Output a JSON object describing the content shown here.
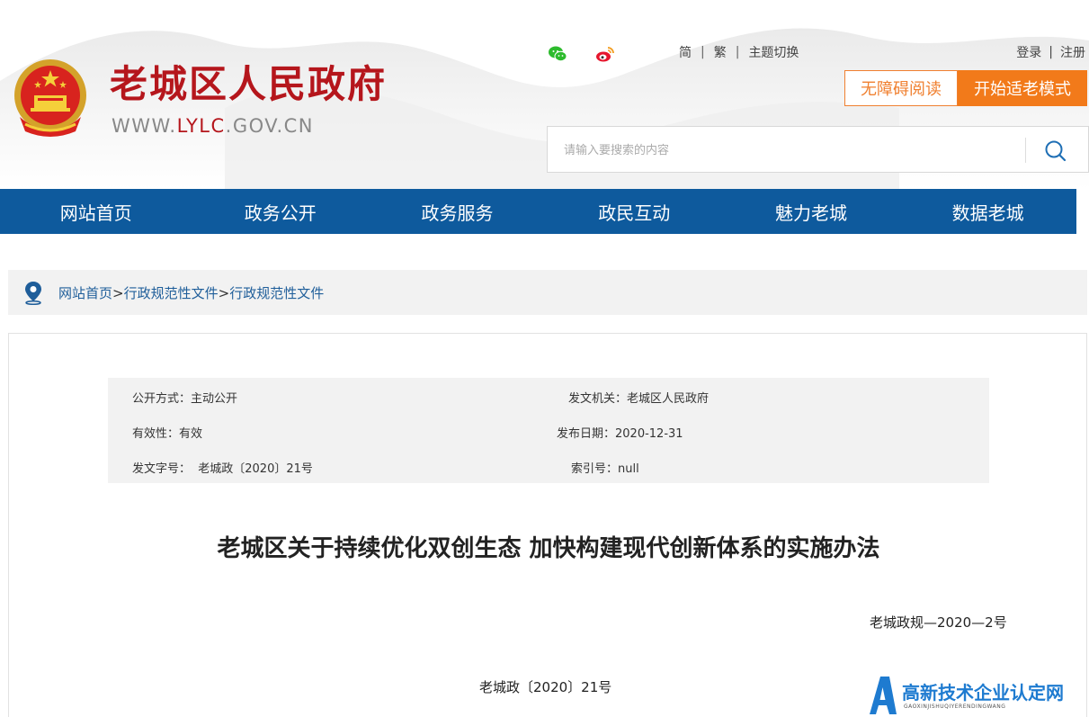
{
  "header": {
    "site_title": "老城区人民政府",
    "site_url_prefix": "WWW.",
    "site_url_accent": "LYLC",
    "site_url_suffix": ".GOV.CN",
    "top_links": {
      "simplified": "简",
      "traditional": "繁",
      "theme": "主题切换"
    },
    "account": {
      "login": "登录",
      "register": "注册"
    },
    "buttons": {
      "accessibility": "无障碍阅读",
      "elder_mode": "开始适老模式"
    },
    "search": {
      "placeholder": "请输入要搜索的内容"
    },
    "icons": [
      "wechat-icon",
      "weibo-icon",
      "search-icon",
      "emblem-icon"
    ]
  },
  "nav": {
    "items": [
      "网站首页",
      "政务公开",
      "政务服务",
      "政民互动",
      "魅力老城",
      "数据老城"
    ]
  },
  "breadcrumb": {
    "items": [
      "网站首页",
      "行政规范性文件",
      "行政规范性文件"
    ],
    "separator": ">"
  },
  "meta": {
    "disclosure": "公开方式：主动公开",
    "issuer": "发文机关：老城区人民政府",
    "validity": "有效性：有效",
    "publish_date": "发布日期：2020-12-31",
    "doc_number": "发文字号：  老城政〔2020〕21号",
    "index_number": "索引号：null"
  },
  "document": {
    "title": "老城区关于持续优化双创生态 加快构建现代创新体系的实施办法",
    "regulation_number": "老城政规—2020—2号",
    "file_number": "老城政〔2020〕21号"
  },
  "watermark": {
    "title": "高新技术企业认定网",
    "subtitle": "GAOXINJISHUQIYERENDINGWANG"
  },
  "colors": {
    "brand_red": "#b5161c",
    "nav_blue": "#0e5a9d",
    "accent_orange": "#f27a1a",
    "link_blue": "#1f5e9a"
  }
}
